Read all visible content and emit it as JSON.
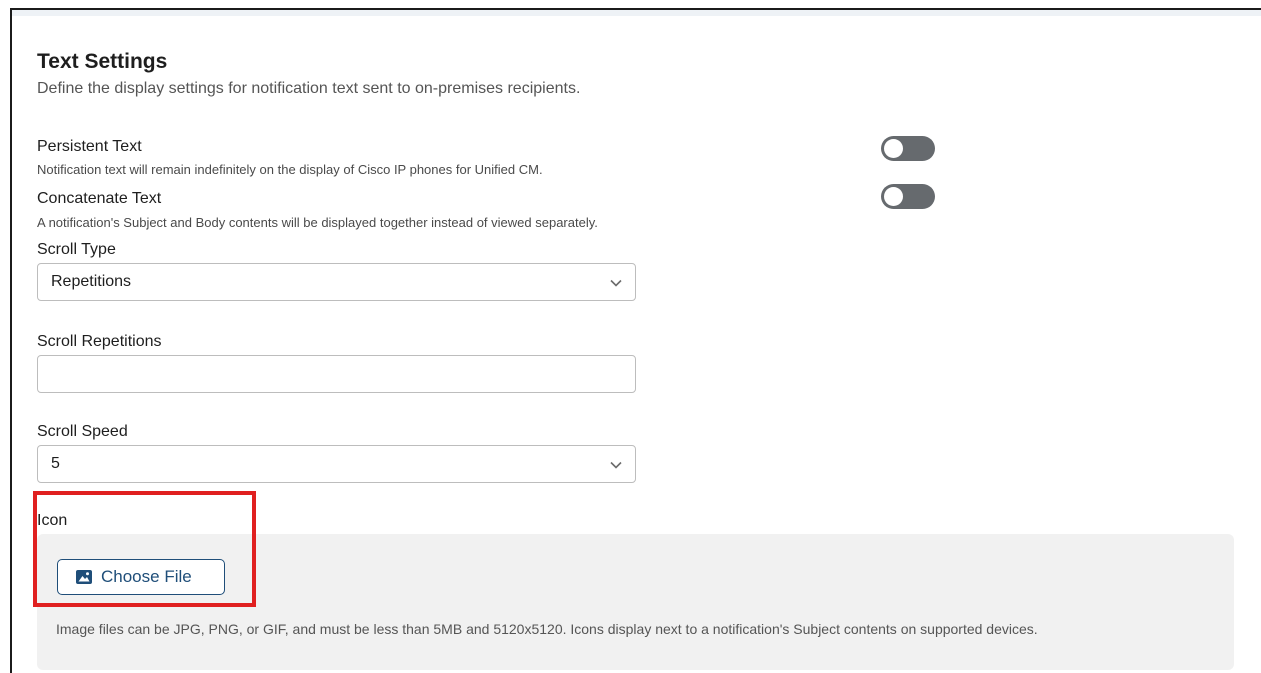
{
  "section": {
    "title": "Text Settings",
    "description": "Define the display settings for notification text sent to on-premises recipients."
  },
  "persistent_text": {
    "title": "Persistent Text",
    "description": "Notification text will remain indefinitely on the display of Cisco IP phones for Unified CM.",
    "enabled": false
  },
  "concatenate_text": {
    "title": "Concatenate Text",
    "description": "A notification's Subject and Body contents will be displayed together instead of viewed separately.",
    "enabled": false
  },
  "scroll_type": {
    "label": "Scroll Type",
    "value": "Repetitions"
  },
  "scroll_repetitions": {
    "label": "Scroll Repetitions",
    "value": ""
  },
  "scroll_speed": {
    "label": "Scroll Speed",
    "value": "5"
  },
  "icon": {
    "label": "Icon",
    "button_label": "Choose File",
    "help": "Image files can be JPG, PNG, or GIF, and must be less than 5MB and 5120x5120. Icons display next to a notification's Subject contents on supported devices."
  },
  "colors": {
    "highlight": "#e02020",
    "button_accent": "#1f4e79",
    "toggle_off": "#666a6e"
  }
}
